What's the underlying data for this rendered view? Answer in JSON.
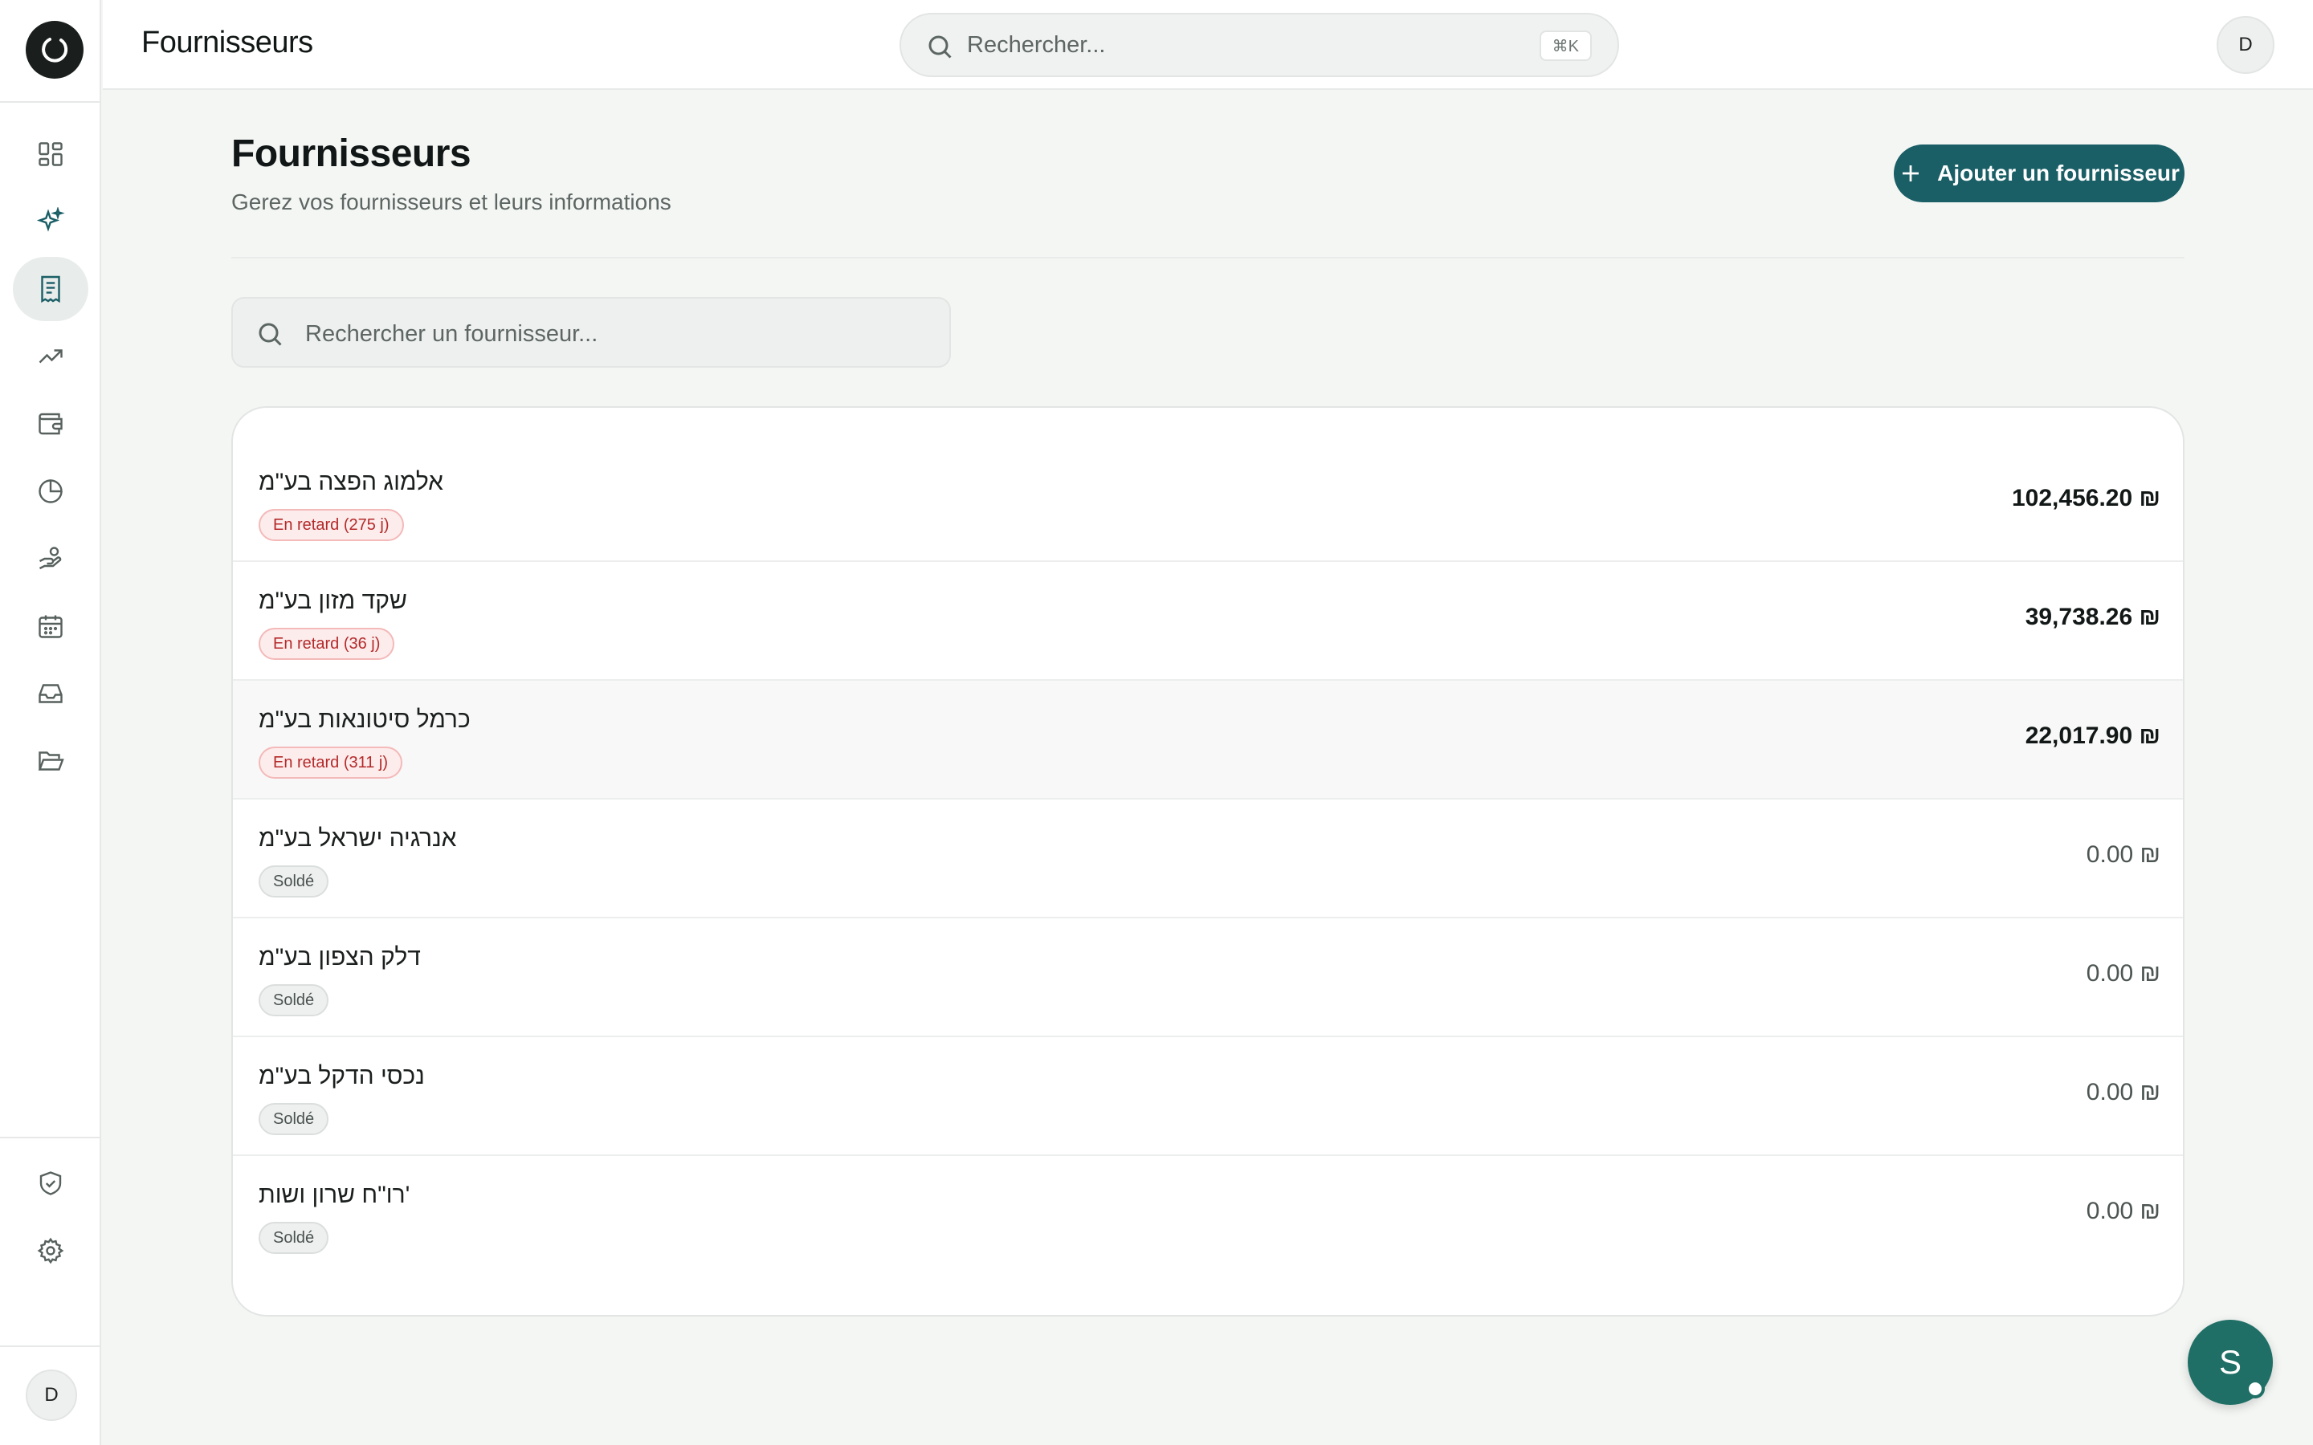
{
  "sidebar": {
    "nav": [
      {
        "icon": "dashboard-grid-icon"
      },
      {
        "icon": "sparkles-icon"
      },
      {
        "icon": "receipt-icon"
      },
      {
        "icon": "trending-up-icon"
      },
      {
        "icon": "wallet-icon"
      },
      {
        "icon": "pie-chart-icon"
      },
      {
        "icon": "hand-coins-icon"
      },
      {
        "icon": "calendar-icon"
      },
      {
        "icon": "inbox-icon"
      },
      {
        "icon": "folder-open-icon"
      }
    ],
    "bottom": [
      {
        "icon": "shield-check-icon"
      },
      {
        "icon": "gear-icon"
      }
    ],
    "user_initial": "D"
  },
  "topbar": {
    "title": "Fournisseurs",
    "search_placeholder": "Rechercher...",
    "shortcut": "⌘K",
    "user_initial": "D"
  },
  "page": {
    "title": "Fournisseurs",
    "subtitle": "Gerez vos fournisseurs et leurs informations",
    "add_button": "Ajouter un fournisseur",
    "search_placeholder": "Rechercher un fournisseur..."
  },
  "suppliers": [
    {
      "name": "אלמוג הפצה בע\"מ",
      "status": "En retard (275 j)",
      "amount": "102,456.20 ₪"
    },
    {
      "name": " שקד מזון בע\"מ",
      "status": "En retard (36 j)",
      "amount": "39,738.26 ₪"
    },
    {
      "name": "כרמל סיטונאות בע\"מ",
      "status": "En retard (311 j)",
      "amount": "22,017.90 ₪"
    },
    {
      "name": "אנרגיה ישראל בע\"מ",
      "status": "Soldé",
      "amount": "0.00 ₪"
    },
    {
      "name": "דלק הצפון בע\"מ",
      "status": "Soldé",
      "amount": "0.00 ₪"
    },
    {
      "name": "נכסי הדקל בע\"מ",
      "status": "Soldé",
      "amount": "0.00 ₪"
    },
    {
      "name": "רו\"ח שרון ושות'",
      "status": "Soldé",
      "amount": "0.00 ₪"
    }
  ],
  "assistant": {
    "initial": "S"
  },
  "colors": {
    "accent": "#1a5e66",
    "late_text": "#b42a2a",
    "late_bg": "#fdecec"
  }
}
